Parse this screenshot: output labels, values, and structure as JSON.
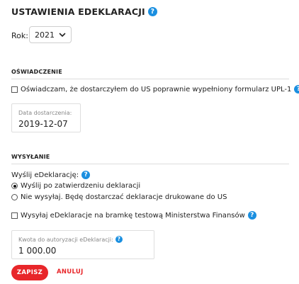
{
  "header": {
    "title": "USTAWIENIA EDEKLARACJI"
  },
  "year": {
    "label": "Rok:",
    "selected": "2021"
  },
  "oswiadczenie": {
    "heading": "OŚWIADCZENIE",
    "checkbox_label": "Oświadczam, że dostarczyłem do US poprawnie wypełniony formularz UPL-1",
    "checkbox_checked": false,
    "date_field": {
      "label": "Data dostarczenia:",
      "value": "2019-12-07"
    }
  },
  "wysylanie": {
    "heading": "WYSYŁANIE",
    "question": "Wyślij eDeklarację:",
    "options": [
      {
        "label": "Wyślij po zatwierdzeniu deklaracji",
        "selected": true
      },
      {
        "label": "Nie wysyłaj. Będę dostarczać deklaracje drukowane do US",
        "selected": false
      }
    ],
    "test_gateway_label": "Wysyłaj eDeklaracje na bramkę testową Ministerstwa Finansów",
    "test_gateway_checked": false,
    "amount_field": {
      "label": "Kwota do autoryzacji eDeklaracji:",
      "value": "1 000.00"
    }
  },
  "actions": {
    "save_label": "ZAPISZ",
    "cancel_label": "ANULUJ"
  },
  "colors": {
    "accent_red": "#e8262a",
    "help_blue": "#1a8fe0"
  }
}
